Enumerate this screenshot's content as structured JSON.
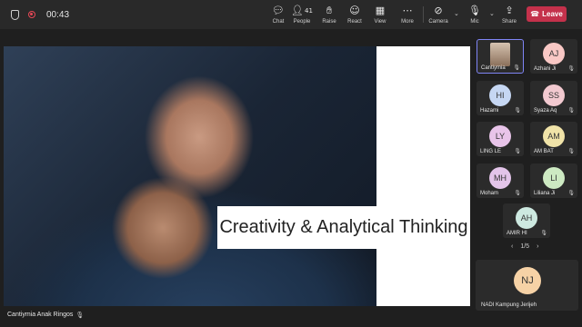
{
  "meeting": {
    "timer": "00:43",
    "leave_label": "Leave"
  },
  "toolbar": {
    "chat": "Chat",
    "people": "People",
    "people_count": "41",
    "raise": "Raise",
    "react": "React",
    "view": "View",
    "more": "More",
    "camera": "Camera",
    "mic": "Mic",
    "share": "Share"
  },
  "stage": {
    "slide_title": "Creativity & Analytical Thinking",
    "presenter_name": "Cantiymia Anak Ringos"
  },
  "participants": [
    {
      "name": "Cantiymia",
      "initials": "",
      "color": "",
      "video": true
    },
    {
      "name": "Azhani Ji",
      "initials": "AJ",
      "color": "#f9c8c5"
    },
    {
      "name": "Hazami",
      "initials": "HI",
      "color": "#c6d7f3"
    },
    {
      "name": "Syaza Aq",
      "initials": "SS",
      "color": "#f2c9d0"
    },
    {
      "name": "LING LE",
      "initials": "LY",
      "color": "#e8c4e9"
    },
    {
      "name": "AM BAT",
      "initials": "AM",
      "color": "#f0e3a8"
    },
    {
      "name": "Moham",
      "initials": "MH",
      "color": "#e3c4e9"
    },
    {
      "name": "Liliana Ji",
      "initials": "LI",
      "color": "#cde9c2"
    },
    {
      "name": "AMIR HI",
      "initials": "AH",
      "color": "#cde9e0"
    }
  ],
  "pager": {
    "label": "1/5"
  },
  "featured": {
    "initials": "NJ",
    "name": "NADI Kampung Jerijeh"
  },
  "colors": {
    "leave": "#c4314b",
    "accent": "#7f85f5"
  }
}
